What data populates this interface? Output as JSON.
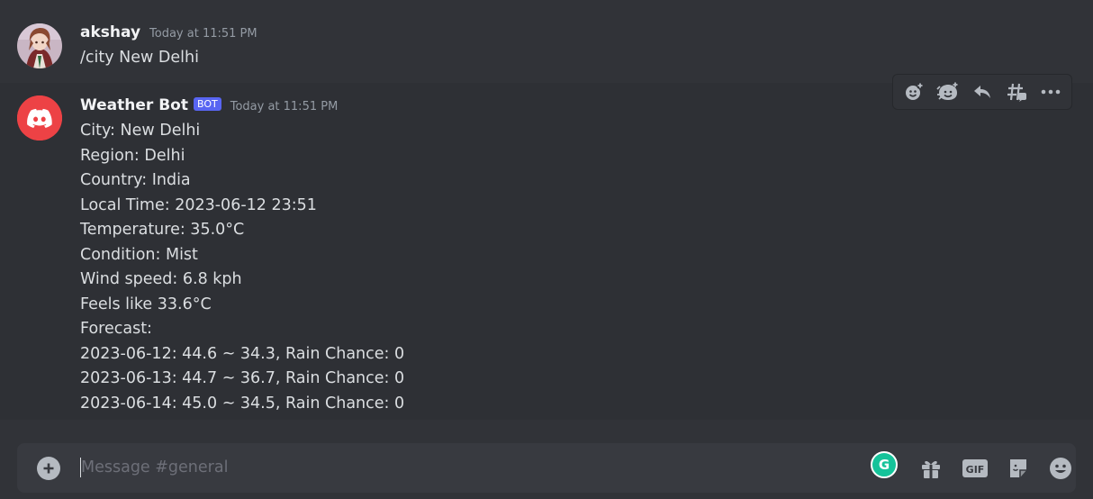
{
  "messages": [
    {
      "username": "akshay",
      "timestamp": "Today at 11:51 PM",
      "avatar_icon": "anime-avatar-icon",
      "lines": [
        "/city New Delhi"
      ]
    },
    {
      "username": "Weather Bot",
      "badge": "BOT",
      "timestamp": "Today at 11:51 PM",
      "avatar_icon": "discord-logo-icon",
      "lines": [
        "City: New Delhi",
        "Region: Delhi",
        "Country: India",
        "Local Time: 2023-06-12 23:51",
        "Temperature: 35.0°C",
        "Condition: Mist",
        "Wind speed: 6.8 kph",
        "Feels like 33.6°C",
        "Forecast:",
        "2023-06-12: 44.6 ~ 34.3, Rain Chance: 0",
        "2023-06-13: 44.7 ~ 36.7, Rain Chance: 0",
        "2023-06-14: 45.0 ~ 34.5, Rain Chance: 0"
      ]
    }
  ],
  "message_toolbar": [
    "add-reaction-icon",
    "super-reaction-icon",
    "reply-icon",
    "create-thread-icon",
    "more-icon"
  ],
  "composer": {
    "placeholder": "Message #general",
    "value": "",
    "grammarly_letter": "G",
    "gif_label": "GIF",
    "icons": [
      "add-attachment-icon",
      "gift-icon",
      "gif-icon",
      "sticker-icon",
      "emoji-icon"
    ]
  },
  "colors": {
    "background": "#313338",
    "composer_bg": "#383a40",
    "bot_badge": "#5865f2",
    "discord_red": "#ed4245",
    "icon_gray": "#b5bac1",
    "grammarly_green": "#15c39a"
  }
}
